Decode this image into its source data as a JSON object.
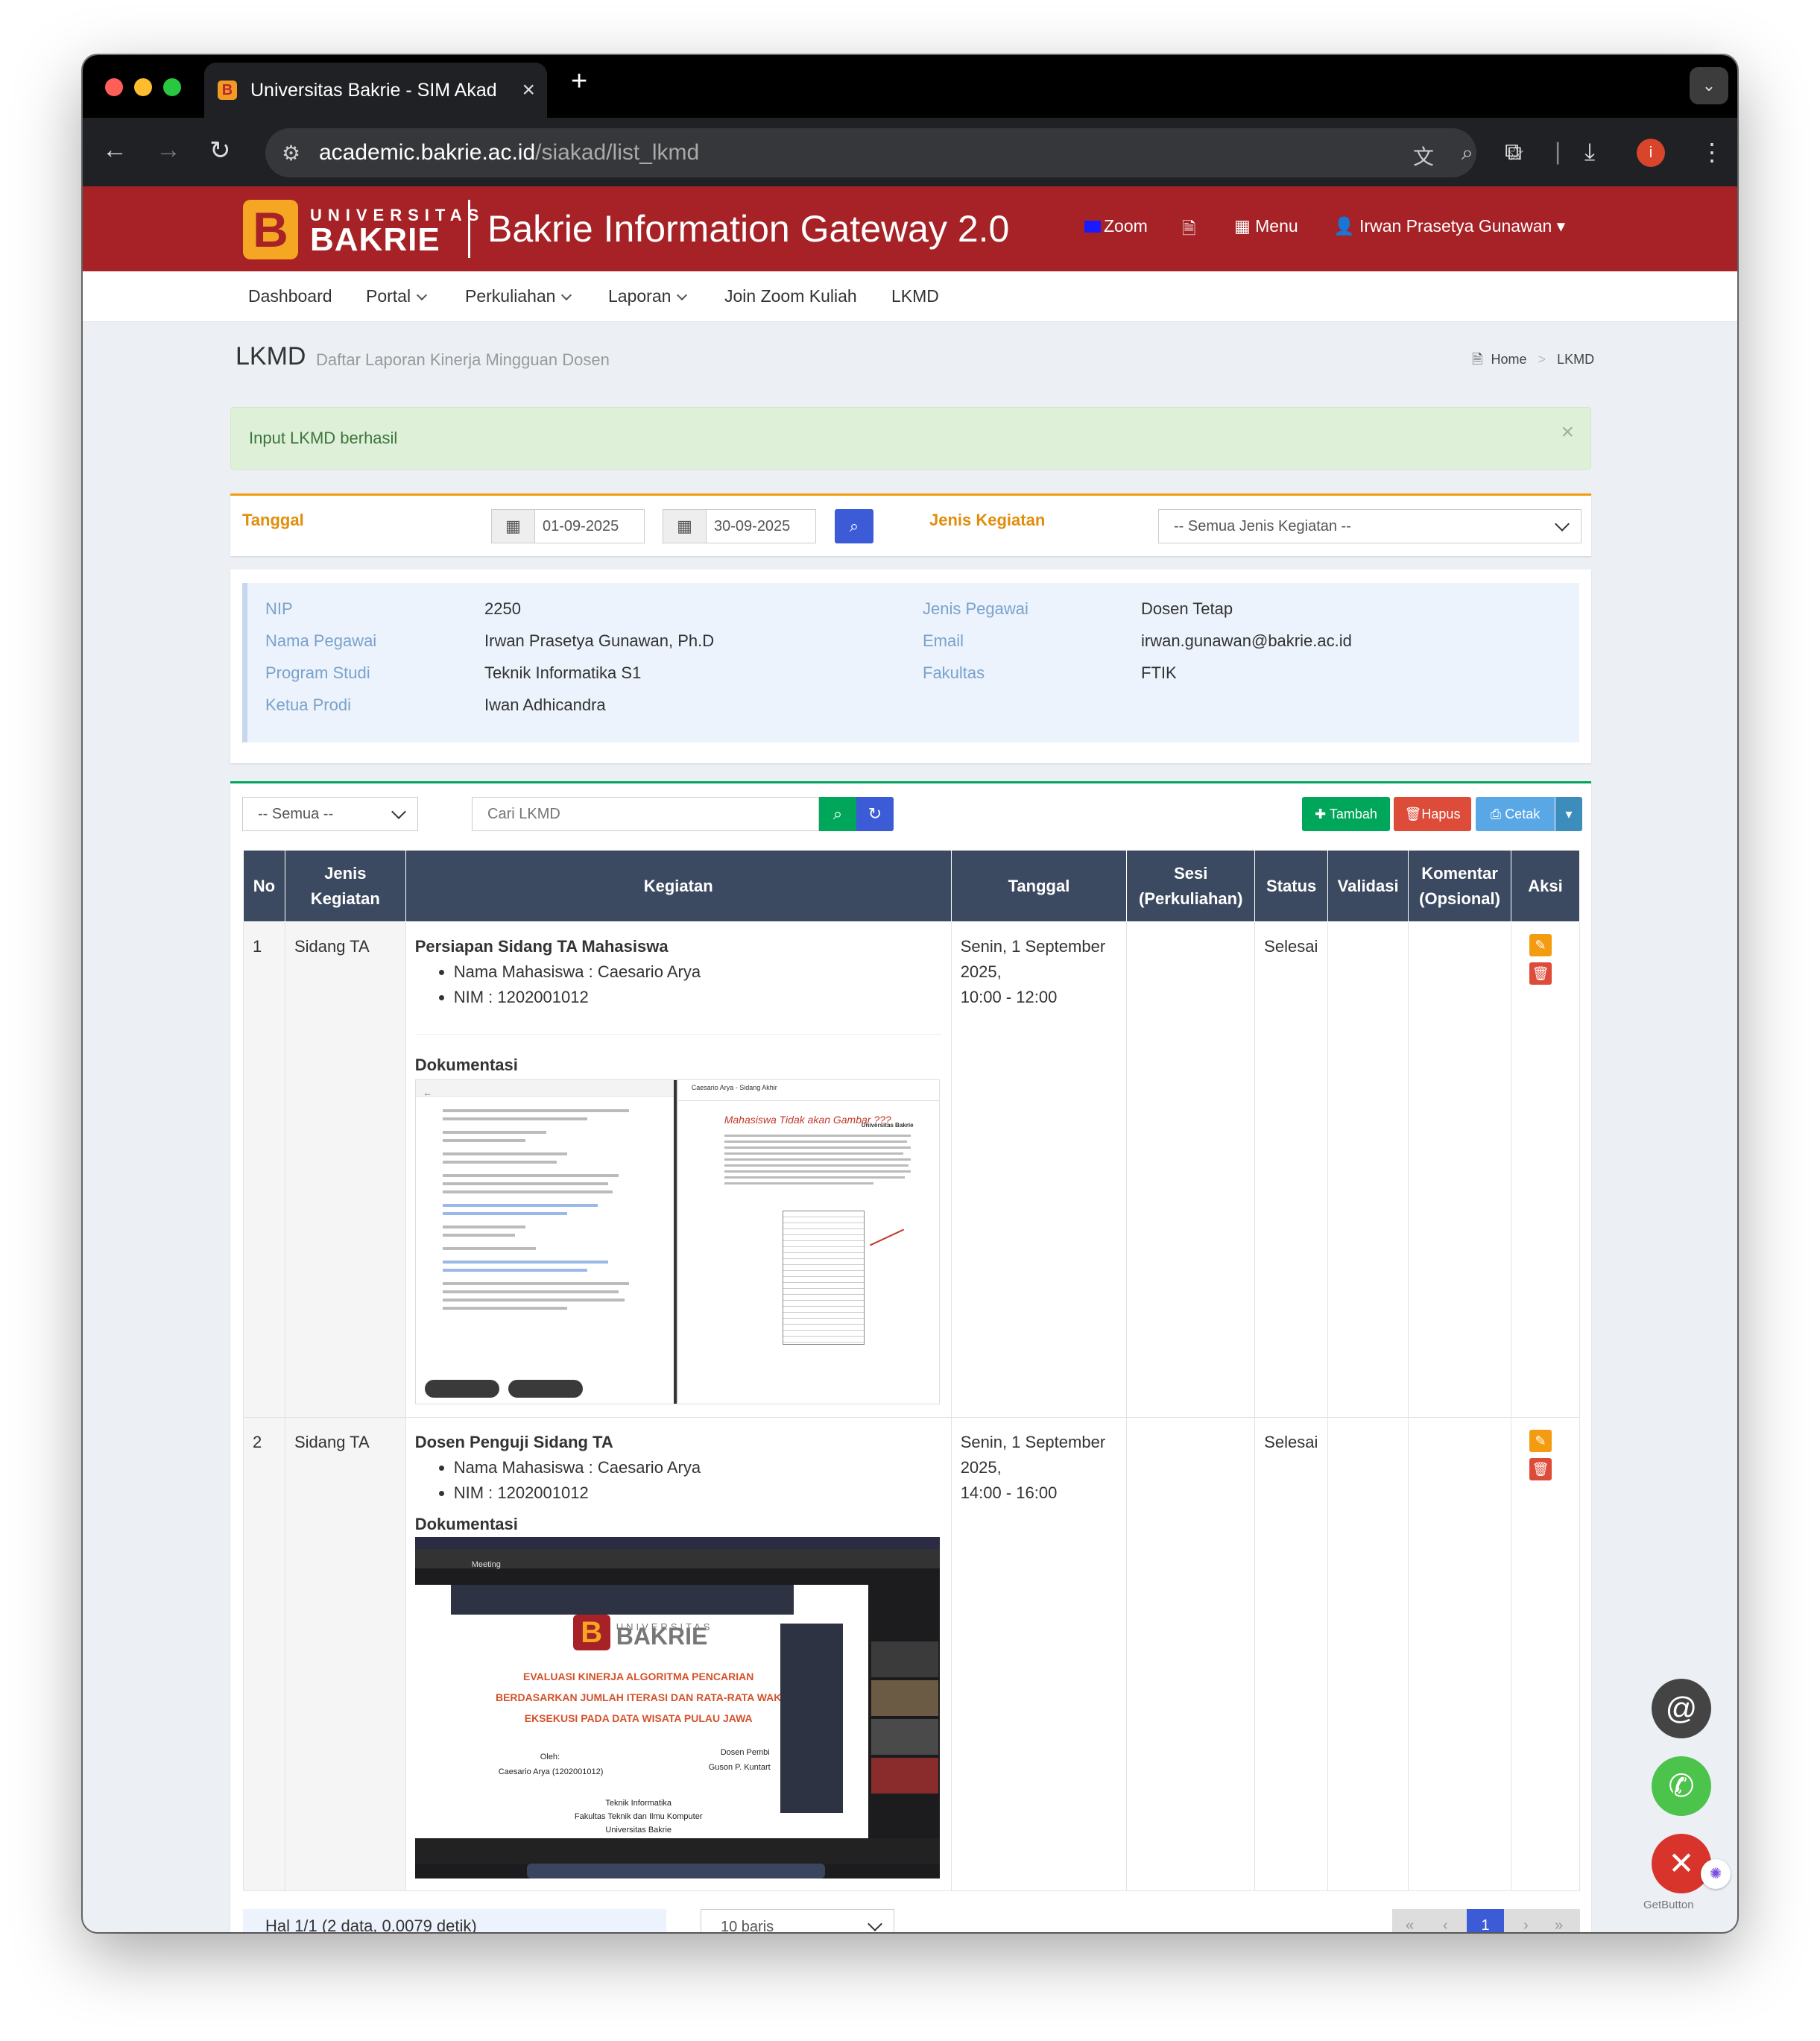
{
  "browser": {
    "tab_title": "Universitas Bakrie - SIM Akad",
    "url_host": "academic.bakrie.ac.id",
    "url_path": "/siakad/list_lkmd"
  },
  "header": {
    "logo_line1": "UNIVERSITAS",
    "logo_line2": "BAKRIE",
    "brand": "Bakrie Information Gateway 2.0",
    "zoom": "Zoom",
    "menu": "Menu",
    "user": "Irwan Prasetya Gunawan"
  },
  "topnav": [
    "Dashboard",
    "Portal",
    "Perkuliahan",
    "Laporan",
    "Join Zoom Kuliah",
    "LKMD"
  ],
  "page": {
    "title": "LKMD",
    "subtitle": "Daftar Laporan Kinerja Mingguan Dosen",
    "breadcrumb_home": "Home",
    "breadcrumb_current": "LKMD"
  },
  "alert": {
    "text": "Input LKMD berhasil",
    "close": "×"
  },
  "filter": {
    "tanggal_label": "Tanggal",
    "date_from": "01-09-2025",
    "date_to": "30-09-2025",
    "jenis_label": "Jenis Kegiatan",
    "jenis_value": "-- Semua Jenis Kegiatan --"
  },
  "profile": {
    "nip_label": "NIP",
    "nip": "2250",
    "nama_label": "Nama Pegawai",
    "nama": "Irwan Prasetya Gunawan, Ph.D",
    "prodi_label": "Program Studi",
    "prodi": "Teknik Informatika S1",
    "ketua_label": "Ketua Prodi",
    "ketua": "Iwan Adhicandra",
    "jenis_label": "Jenis Pegawai",
    "jenis": "Dosen Tetap",
    "email_label": "Email",
    "email": "irwan.gunawan@bakrie.ac.id",
    "fakultas_label": "Fakultas",
    "fakultas": "FTIK"
  },
  "toolbar": {
    "filter_select": "-- Semua --",
    "search_placeholder": "Cari LKMD",
    "tambah": "Tambah",
    "hapus": "Hapus",
    "cetak": "Cetak"
  },
  "table": {
    "headers": {
      "no": "No",
      "jenis": "Jenis Kegiatan",
      "kegiatan": "Kegiatan",
      "tanggal": "Tanggal",
      "sesi": "Sesi (Perkuliahan)",
      "status": "Status",
      "validasi": "Validasi",
      "komentar": "Komentar (Opsional)",
      "aksi": "Aksi"
    },
    "doc_label": "Dokumentasi",
    "rows": [
      {
        "no": "1",
        "jenis": "Sidang TA",
        "title": "Persiapan Sidang TA Mahasiswa",
        "bullets": [
          "Nama Mahasiswa : Caesario Arya",
          "NIM : 1202001012"
        ],
        "date": "Senin, 1 September 2025,",
        "time": "10:00 - 12:00",
        "status": "Selesai"
      },
      {
        "no": "2",
        "jenis": "Sidang TA",
        "title": "Dosen Penguji Sidang TA",
        "bullets": [
          "Nama Mahasiswa : Caesario Arya",
          "NIM : 1202001012"
        ],
        "date": "Senin, 1 September 2025,",
        "time": "14:00 - 16:00",
        "status": "Selesai"
      }
    ]
  },
  "doc1": {
    "right_title": "Caesario Arya - Sidang Akhir",
    "right_note": "Mahasiswa Tidak akan Gambar ???",
    "right_inst": "Universitas Bakrie"
  },
  "slide": {
    "logo_small": "UNIVERSITAS",
    "logo": "BAKRIE",
    "t1": "EVALUASI KINERJA ALGORITMA PENCARIAN",
    "t2": "BERDASARKAN JUMLAH ITERASI DAN RATA-RATA WAK",
    "t3": "EKSEKUSI PADA DATA WISATA PULAU JAWA",
    "oleh": "Oleh:",
    "author": "Caesario Arya (1202001012)",
    "pemb": "Dosen Pembi",
    "pemb_name": "Guson P. Kuntart",
    "dept1": "Teknik Informatika",
    "dept2": "Fakultas Teknik dan Ilmu Komputer",
    "dept3": "Universitas Bakrie",
    "meeting": "Meeting"
  },
  "footer": {
    "info": "Hal 1/1 (2 data, 0.0079 detik)",
    "rows": "10 baris",
    "page": "1"
  },
  "widget": {
    "brand": "GetButton"
  },
  "colors": {
    "header_red": "#a62226",
    "table_head": "#3c4a61",
    "accent_orange": "#e08e0b",
    "search_blue": "#3c5bd6"
  }
}
